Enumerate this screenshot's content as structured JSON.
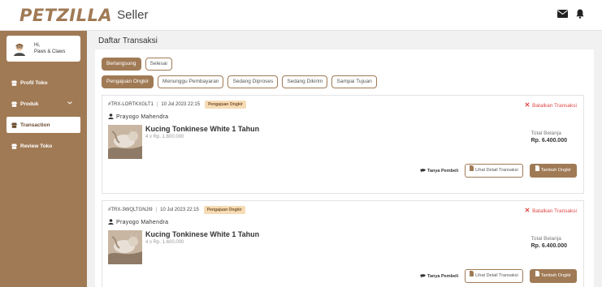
{
  "app": {
    "brand": "PETZILLA",
    "brand_sub": "Seller"
  },
  "header": {
    "icons": [
      "mail-icon",
      "bell-icon"
    ]
  },
  "sidebar": {
    "greeting": "Hi,",
    "user_name": "Paws & Claws",
    "items": [
      {
        "label": "Profil Toko",
        "icon": "store-icon",
        "active": false
      },
      {
        "label": "Produk",
        "icon": "store-icon",
        "active": false,
        "has_dropdown": true
      },
      {
        "label": "Transaction",
        "icon": "store-icon",
        "active": true
      },
      {
        "label": "Review Toko",
        "icon": "store-icon",
        "active": false
      }
    ]
  },
  "main": {
    "title": "Daftar Transaksi",
    "status_tabs": [
      {
        "label": "Berlangsung",
        "selected": true
      },
      {
        "label": "Selesai",
        "selected": false
      }
    ],
    "stage_tabs": [
      {
        "label": "Pengajuan Ongkir",
        "selected": true
      },
      {
        "label": "Menunggu Pembayaran",
        "selected": false
      },
      {
        "label": "Sedang Diproses",
        "selected": false
      },
      {
        "label": "Sedang Dikirim",
        "selected": false
      },
      {
        "label": "Sampai Tujuan",
        "selected": false
      }
    ],
    "transactions": [
      {
        "id": "#TRX-LORTKXGLT1",
        "date": "10 Jul 2023 22:15",
        "status": "Pengajuan Ongkir",
        "cancel_label": "Batalkan Transaksi",
        "buyer": "Prayogo Mahendra",
        "product_name": "Kucing Tonkinese White 1 Tahun",
        "product_qty": "4 x Rp. 1.600.000",
        "total_label": "Total Belanja",
        "total_amount": "Rp. 6.400.000",
        "chat_label": "Tanya Pembeli",
        "detail_label": "Lihat Detail Transaksi",
        "shipping_label": "Tambah Ongkir"
      },
      {
        "id": "#TRX-3WQLTGNJI9",
        "date": "10 Jul 2023 22:15",
        "status": "Pengajuan Ongkir",
        "cancel_label": "Batalkan Transaksi",
        "buyer": "Prayogo Mahendra",
        "product_name": "Kucing Tonkinese White 1 Tahun",
        "product_qty": "4 x Rp. 1.600.000",
        "total_label": "Total Belanja",
        "total_amount": "Rp. 6.400.000",
        "chat_label": "Tanya Pembeli",
        "detail_label": "Lihat Detail Transaksi",
        "shipping_label": "Tambah Ongkir"
      }
    ]
  },
  "colors": {
    "brand": "#a07a55",
    "cancel": "#e04848",
    "badge_bg": "#f6dcb5"
  }
}
